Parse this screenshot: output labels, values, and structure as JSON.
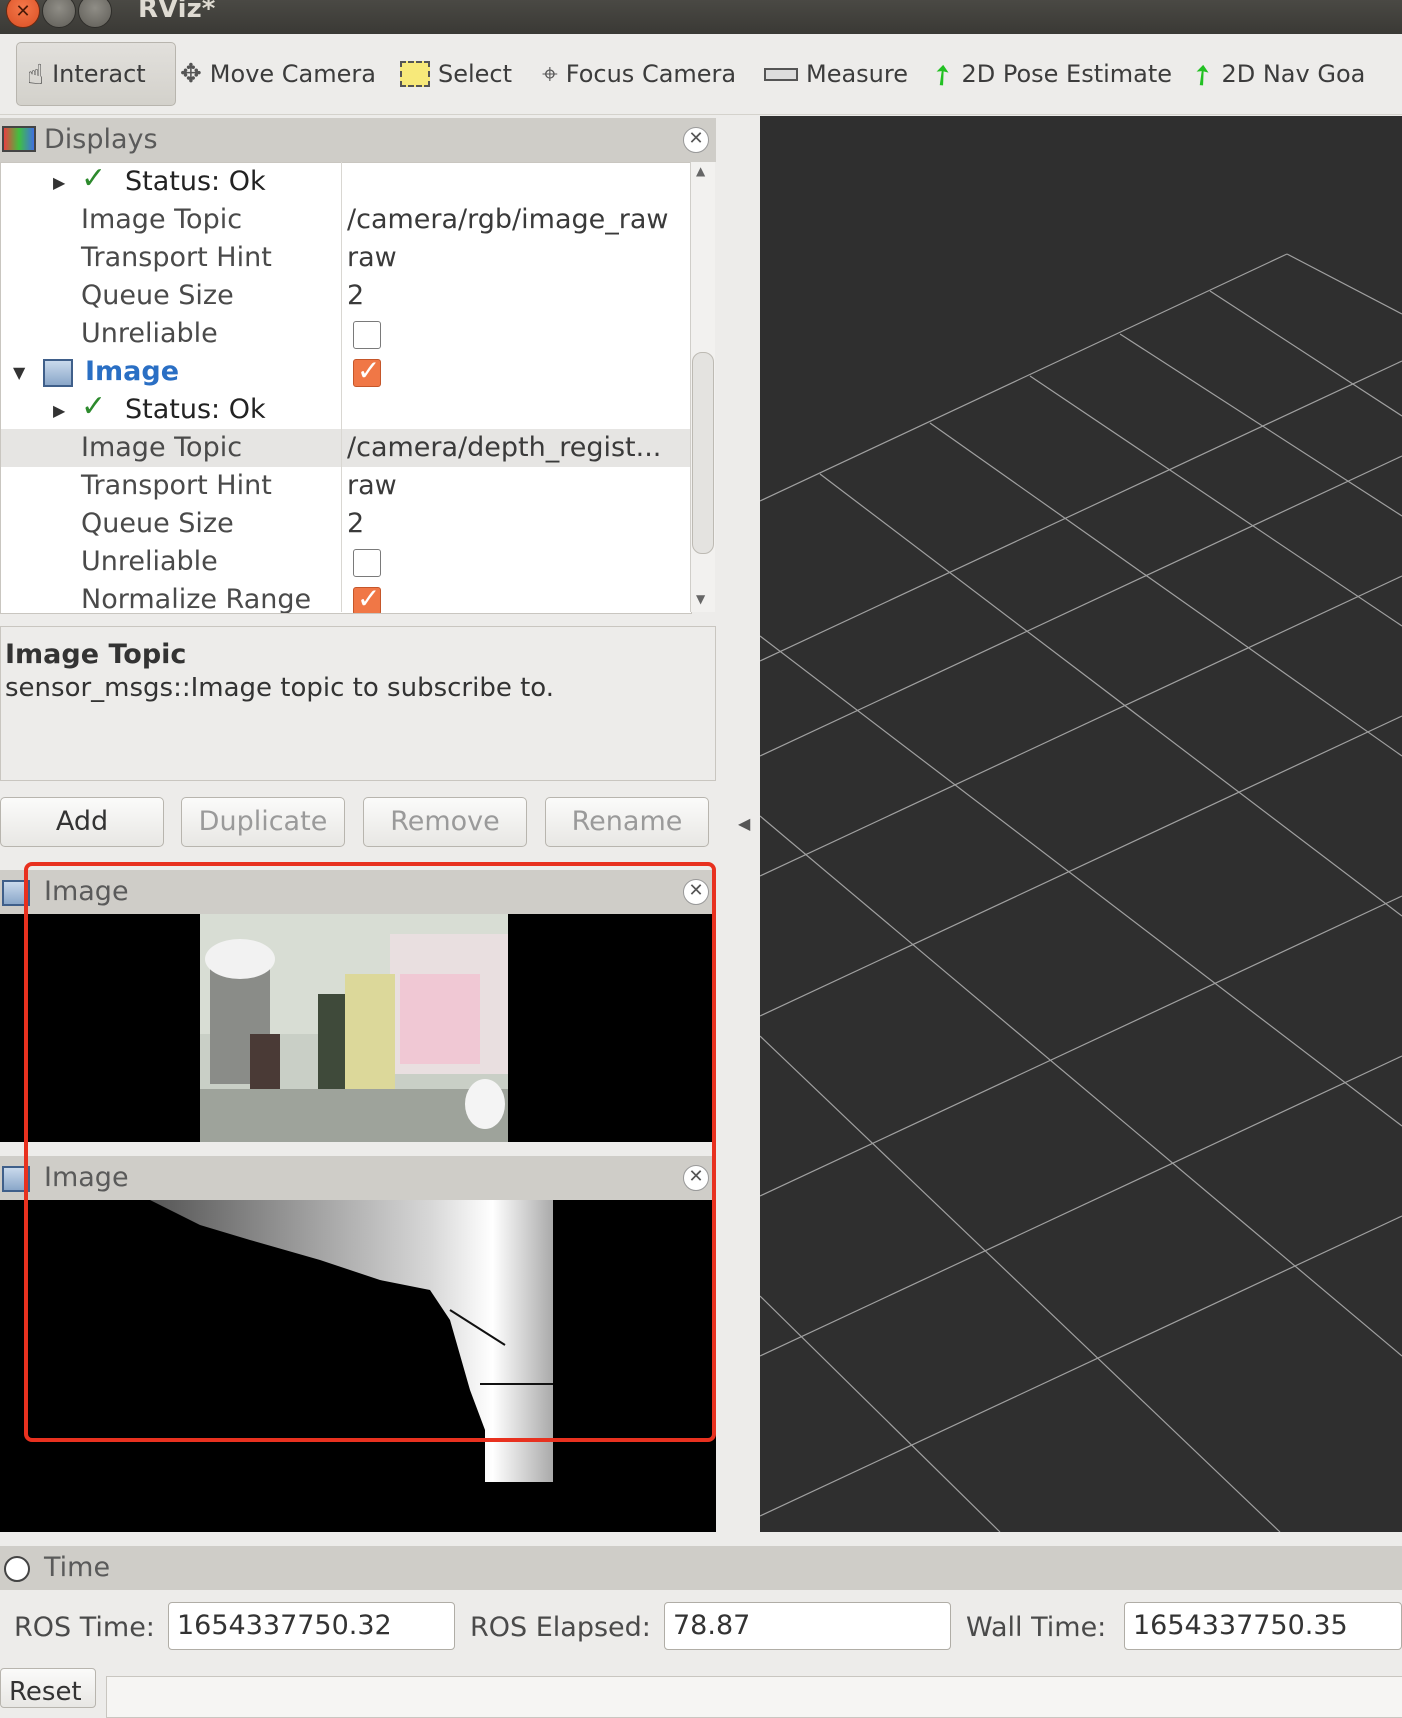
{
  "window": {
    "title": "RViz*"
  },
  "toolbar": {
    "tools": [
      {
        "label": "Interact",
        "icon": "hand-icon"
      },
      {
        "label": "Move Camera",
        "icon": "move-icon"
      },
      {
        "label": "Select",
        "icon": "select-box-icon"
      },
      {
        "label": "Focus Camera",
        "icon": "focus-icon"
      },
      {
        "label": "Measure",
        "icon": "ruler-icon"
      },
      {
        "label": "2D Pose Estimate",
        "icon": "green-arrow-icon"
      },
      {
        "label": "2D Nav Goa",
        "icon": "green-arrow-icon"
      }
    ]
  },
  "displays": {
    "title": "Displays",
    "rows": [
      {
        "key": "Status: Ok",
        "value": ""
      },
      {
        "key": "Image Topic",
        "value": "/camera/rgb/image_raw"
      },
      {
        "key": "Transport Hint",
        "value": "raw"
      },
      {
        "key": "Queue Size",
        "value": "2"
      },
      {
        "key": "Unreliable",
        "checked": false
      },
      {
        "key": "Image",
        "checked": true
      },
      {
        "key": "Status: Ok",
        "value": ""
      },
      {
        "key": "Image Topic",
        "value": "/camera/depth_regist..."
      },
      {
        "key": "Transport Hint",
        "value": "raw"
      },
      {
        "key": "Queue Size",
        "value": "2"
      },
      {
        "key": "Unreliable",
        "checked": false
      },
      {
        "key": "Normalize Range",
        "checked": true
      }
    ]
  },
  "description": {
    "title": "Image Topic",
    "text": "sensor_msgs::Image topic to subscribe to."
  },
  "panel_buttons": {
    "add": "Add",
    "duplicate": "Duplicate",
    "remove": "Remove",
    "rename": "Rename"
  },
  "image_panels": [
    {
      "title": "Image"
    },
    {
      "title": "Image"
    }
  ],
  "time": {
    "title": "Time",
    "ros_time_label": "ROS Time:",
    "ros_time": "1654337750.32",
    "ros_elapsed_label": "ROS Elapsed:",
    "ros_elapsed": "78.87",
    "wall_time_label": "Wall Time:",
    "wall_time": "1654337750.35",
    "reset": "Reset"
  },
  "colors": {
    "highlight": "#e8311f",
    "checkbox_on": "#f07746",
    "view_bg": "#2f2f2f",
    "selected_display": "#2a6fc4"
  }
}
